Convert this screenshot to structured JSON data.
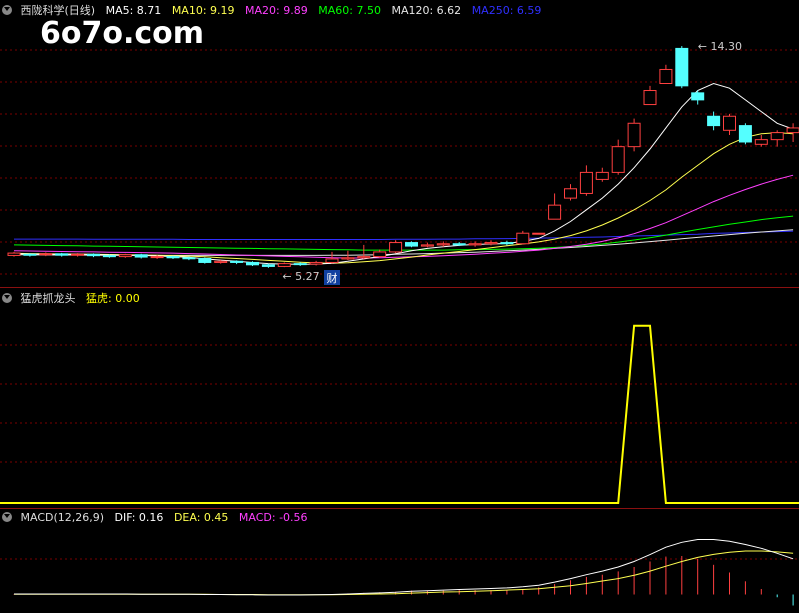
{
  "watermark": "6o7o.com",
  "colors": {
    "up": "#ff4040",
    "down": "#54ffff",
    "grid": "#7a0000",
    "ma5": "#ffffff",
    "ma10": "#ffff50",
    "ma20": "#ff40ff",
    "ma60": "#00ff00",
    "ma120": "#e6e6e6",
    "ma250": "#3030ff",
    "macd_pos": "#ff4040",
    "macd_neg": "#54ffff",
    "signal": "#ffff00"
  },
  "header1": {
    "name": "西陇科学(日线)",
    "ma5": "MA5: 8.71",
    "ma10": "MA10: 9.19",
    "ma20": "MA20: 9.89",
    "ma60": "MA60: 7.50",
    "ma120": "MA120: 6.62",
    "ma250": "MA250: 6.59"
  },
  "header2": {
    "name": "猛虎抓龙头",
    "value": "猛虎: 0.00"
  },
  "header3": {
    "name": "MACD(12,26,9)",
    "dif": "DIF: 0.16",
    "dea": "DEA: 0.45",
    "macd": "MACD: -0.56"
  },
  "chart_data": [
    {
      "type": "candlestick",
      "ylim": [
        4.3,
        15.5
      ],
      "annotations": {
        "high_label": "14.30",
        "low_label": "5.27",
        "event_label": "财"
      },
      "candles": [
        [
          5.35,
          5.45,
          5.3,
          5.5
        ],
        [
          5.4,
          5.38,
          5.3,
          5.45
        ],
        [
          5.38,
          5.42,
          5.32,
          5.48
        ],
        [
          5.42,
          5.36,
          5.3,
          5.46
        ],
        [
          5.36,
          5.4,
          5.3,
          5.45
        ],
        [
          5.4,
          5.34,
          5.28,
          5.44
        ],
        [
          5.34,
          5.3,
          5.25,
          5.4
        ],
        [
          5.3,
          5.38,
          5.25,
          5.42
        ],
        [
          5.38,
          5.28,
          5.22,
          5.42
        ],
        [
          5.28,
          5.3,
          5.2,
          5.36
        ],
        [
          5.3,
          5.25,
          5.2,
          5.34
        ],
        [
          5.25,
          5.22,
          5.15,
          5.3
        ],
        [
          5.22,
          5.05,
          5.0,
          5.26
        ],
        [
          5.05,
          5.1,
          5.0,
          5.15
        ],
        [
          5.1,
          5.05,
          4.98,
          5.14
        ],
        [
          5.05,
          4.95,
          4.9,
          5.1
        ],
        [
          4.95,
          4.88,
          4.82,
          5.0
        ],
        [
          4.88,
          5.0,
          4.85,
          5.05
        ],
        [
          5.0,
          4.98,
          4.9,
          5.06
        ],
        [
          4.98,
          5.05,
          4.92,
          5.12
        ],
        [
          5.05,
          5.2,
          5.0,
          5.5
        ],
        [
          5.2,
          5.25,
          5.15,
          5.55
        ],
        [
          5.25,
          5.3,
          5.2,
          5.8
        ],
        [
          5.3,
          5.5,
          5.25,
          5.6
        ],
        [
          5.5,
          5.9,
          5.45,
          6.0
        ],
        [
          5.9,
          5.75,
          5.7,
          5.95
        ],
        [
          5.75,
          5.8,
          5.7,
          5.9
        ],
        [
          5.8,
          5.85,
          5.72,
          5.95
        ],
        [
          5.85,
          5.8,
          5.75,
          5.92
        ],
        [
          5.8,
          5.85,
          5.72,
          5.95
        ],
        [
          5.85,
          5.9,
          5.78,
          6.0
        ],
        [
          5.9,
          5.85,
          5.78,
          5.98
        ],
        [
          5.85,
          6.3,
          5.82,
          6.4
        ],
        [
          6.3,
          6.3,
          6.3,
          6.3
        ],
        [
          6.9,
          7.5,
          6.9,
          8.0
        ],
        [
          7.8,
          8.2,
          7.7,
          8.4
        ],
        [
          8.0,
          8.9,
          7.9,
          9.2
        ],
        [
          8.6,
          8.9,
          8.5,
          9.1
        ],
        [
          8.9,
          10.0,
          8.8,
          10.3
        ],
        [
          10.0,
          11.0,
          9.8,
          11.2
        ],
        [
          11.8,
          12.4,
          11.8,
          12.6
        ],
        [
          12.7,
          13.3,
          12.7,
          13.5
        ],
        [
          14.2,
          12.6,
          12.5,
          14.3
        ],
        [
          12.3,
          12.0,
          11.8,
          12.4
        ],
        [
          11.3,
          10.9,
          10.7,
          11.5
        ],
        [
          10.7,
          11.3,
          10.5,
          11.4
        ],
        [
          10.9,
          10.2,
          10.1,
          11.0
        ],
        [
          10.1,
          10.3,
          10.0,
          10.5
        ],
        [
          10.3,
          10.6,
          10.0,
          10.7
        ],
        [
          10.6,
          10.8,
          10.2,
          11.0
        ]
      ],
      "series": [
        {
          "name": "MA5",
          "values": [
            5.42,
            5.41,
            5.4,
            5.4,
            5.4,
            5.39,
            5.37,
            5.36,
            5.35,
            5.33,
            5.3,
            5.27,
            5.2,
            5.15,
            5.1,
            5.05,
            5.0,
            4.98,
            4.97,
            4.98,
            5.02,
            5.1,
            5.2,
            5.3,
            5.42,
            5.55,
            5.65,
            5.72,
            5.78,
            5.82,
            5.84,
            5.86,
            5.95,
            6.08,
            6.4,
            6.8,
            7.3,
            7.8,
            8.4,
            9.1,
            9.9,
            10.8,
            11.7,
            12.4,
            12.7,
            12.5,
            12.0,
            11.5,
            11.0,
            10.75
          ]
        },
        {
          "name": "MA10",
          "values": [
            5.44,
            5.43,
            5.42,
            5.41,
            5.41,
            5.4,
            5.39,
            5.38,
            5.37,
            5.36,
            5.34,
            5.32,
            5.29,
            5.25,
            5.22,
            5.18,
            5.14,
            5.1,
            5.06,
            5.03,
            5.02,
            5.04,
            5.08,
            5.13,
            5.2,
            5.28,
            5.37,
            5.45,
            5.52,
            5.6,
            5.68,
            5.76,
            5.84,
            5.93,
            6.05,
            6.2,
            6.4,
            6.65,
            6.95,
            7.3,
            7.7,
            8.15,
            8.7,
            9.2,
            9.7,
            10.1,
            10.4,
            10.55,
            10.6,
            10.55
          ]
        },
        {
          "name": "MA20",
          "values": [
            5.55,
            5.54,
            5.53,
            5.52,
            5.51,
            5.5,
            5.49,
            5.48,
            5.47,
            5.46,
            5.45,
            5.43,
            5.41,
            5.39,
            5.37,
            5.35,
            5.33,
            5.31,
            5.29,
            5.27,
            5.25,
            5.24,
            5.24,
            5.25,
            5.27,
            5.29,
            5.31,
            5.34,
            5.37,
            5.4,
            5.44,
            5.48,
            5.53,
            5.58,
            5.65,
            5.73,
            5.83,
            5.95,
            6.1,
            6.28,
            6.5,
            6.75,
            7.05,
            7.35,
            7.65,
            7.92,
            8.17,
            8.4,
            8.6,
            8.78
          ]
        },
        {
          "name": "MA60",
          "values": [
            5.8,
            5.79,
            5.78,
            5.77,
            5.76,
            5.75,
            5.74,
            5.73,
            5.72,
            5.71,
            5.7,
            5.69,
            5.68,
            5.67,
            5.66,
            5.65,
            5.64,
            5.63,
            5.62,
            5.61,
            5.6,
            5.59,
            5.58,
            5.58,
            5.58,
            5.58,
            5.58,
            5.58,
            5.59,
            5.6,
            5.61,
            5.62,
            5.64,
            5.66,
            5.69,
            5.73,
            5.78,
            5.84,
            5.92,
            6.01,
            6.11,
            6.22,
            6.34,
            6.46,
            6.57,
            6.68,
            6.78,
            6.88,
            6.96,
            7.03
          ]
        },
        {
          "name": "MA120",
          "values": [
            5.38,
            5.38,
            5.37,
            5.37,
            5.37,
            5.36,
            5.36,
            5.36,
            5.35,
            5.35,
            5.35,
            5.35,
            5.35,
            5.35,
            5.35,
            5.35,
            5.35,
            5.35,
            5.35,
            5.35,
            5.36,
            5.36,
            5.37,
            5.38,
            5.4,
            5.41,
            5.43,
            5.45,
            5.47,
            5.49,
            5.52,
            5.55,
            5.58,
            5.61,
            5.65,
            5.69,
            5.73,
            5.78,
            5.83,
            5.88,
            5.94,
            6.0,
            6.06,
            6.12,
            6.18,
            6.24,
            6.3,
            6.35,
            6.4,
            6.45
          ]
        },
        {
          "name": "MA250",
          "values": [
            6.05,
            6.05,
            6.05,
            6.05,
            6.05,
            6.04,
            6.04,
            6.04,
            6.04,
            6.04,
            6.04,
            6.03,
            6.03,
            6.03,
            6.03,
            6.03,
            6.03,
            6.03,
            6.03,
            6.03,
            6.03,
            6.03,
            6.03,
            6.03,
            6.04,
            6.04,
            6.04,
            6.05,
            6.05,
            6.06,
            6.06,
            6.07,
            6.08,
            6.09,
            6.1,
            6.11,
            6.13,
            6.14,
            6.16,
            6.18,
            6.2,
            6.22,
            6.24,
            6.26,
            6.29,
            6.31,
            6.33,
            6.35,
            6.37,
            6.39
          ]
        }
      ]
    },
    {
      "type": "line",
      "ylim": [
        0,
        1.1
      ],
      "series": [
        {
          "values": [
            0,
            0,
            0,
            0,
            0,
            0,
            0,
            0,
            0,
            0,
            0,
            0,
            0,
            0,
            0,
            0,
            0,
            0,
            0,
            0,
            0,
            0,
            0,
            0,
            0,
            0,
            0,
            0,
            0,
            0,
            0,
            0,
            0,
            0,
            0,
            0,
            0,
            0,
            0,
            1,
            1,
            0,
            0,
            0,
            0,
            0,
            0,
            0,
            0,
            0
          ]
        }
      ]
    },
    {
      "type": "bar",
      "ylim": [
        -0.6,
        2.6
      ],
      "series": [
        {
          "name": "DIF",
          "values": [
            0.02,
            0.02,
            0.02,
            0.02,
            0.02,
            0.02,
            0.02,
            0.02,
            0.01,
            0.01,
            0.01,
            0.01,
            0.0,
            0.0,
            -0.01,
            -0.01,
            -0.02,
            -0.02,
            -0.02,
            -0.01,
            0.0,
            0.02,
            0.04,
            0.06,
            0.08,
            0.12,
            0.14,
            0.16,
            0.18,
            0.2,
            0.22,
            0.24,
            0.28,
            0.34,
            0.45,
            0.58,
            0.72,
            0.85,
            1.0,
            1.2,
            1.45,
            1.72,
            1.9,
            2.0,
            2.0,
            1.94,
            1.82,
            1.68,
            1.5,
            1.3
          ]
        },
        {
          "name": "DEA",
          "values": [
            0.01,
            0.01,
            0.01,
            0.01,
            0.01,
            0.01,
            0.01,
            0.01,
            0.01,
            0.01,
            0.01,
            0.01,
            0.01,
            0.0,
            0.0,
            0.0,
            -0.01,
            -0.01,
            -0.01,
            -0.01,
            -0.01,
            0.0,
            0.01,
            0.02,
            0.03,
            0.05,
            0.07,
            0.09,
            0.1,
            0.12,
            0.14,
            0.16,
            0.18,
            0.21,
            0.26,
            0.32,
            0.4,
            0.49,
            0.58,
            0.7,
            0.85,
            1.03,
            1.2,
            1.35,
            1.46,
            1.54,
            1.58,
            1.58,
            1.55,
            1.5
          ]
        },
        {
          "name": "MACD",
          "values": [
            0.02,
            0.02,
            0.02,
            0.02,
            0.02,
            0.02,
            0.02,
            0.02,
            0.0,
            0.0,
            0.0,
            0.0,
            -0.02,
            0.0,
            -0.02,
            -0.02,
            -0.02,
            -0.02,
            -0.02,
            0.0,
            0.02,
            0.04,
            0.06,
            0.08,
            0.1,
            0.14,
            0.14,
            0.14,
            0.16,
            0.16,
            0.16,
            0.16,
            0.2,
            0.26,
            0.38,
            0.52,
            0.64,
            0.72,
            0.84,
            1.0,
            1.2,
            1.38,
            1.4,
            1.3,
            1.08,
            0.8,
            0.48,
            0.2,
            -0.1,
            -0.4
          ]
        }
      ]
    }
  ]
}
